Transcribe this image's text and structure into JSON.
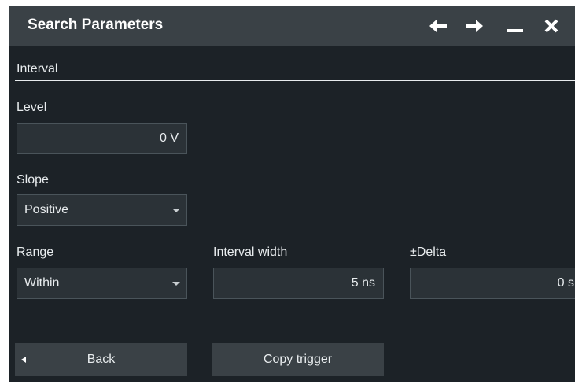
{
  "window": {
    "title": "Search Parameters",
    "controls": [
      "arrow-left-icon",
      "arrow-right-icon",
      "minimize-icon",
      "close-icon"
    ]
  },
  "section": {
    "title": "Interval"
  },
  "level": {
    "label": "Level",
    "value": "0 V"
  },
  "slope": {
    "label": "Slope",
    "value": "Positive"
  },
  "range": {
    "label": "Range",
    "value": "Within"
  },
  "interval_width": {
    "label": "Interval width",
    "value": "5 ns"
  },
  "delta": {
    "label": "±Delta",
    "value": "0 s"
  },
  "buttons": {
    "back": "Back",
    "copy_trigger": "Copy trigger"
  },
  "colors": {
    "background": "#1c2227",
    "titlebar": "#3a4146",
    "field": "#2b3237",
    "button": "#3a4146",
    "text": "#e8ecee"
  }
}
